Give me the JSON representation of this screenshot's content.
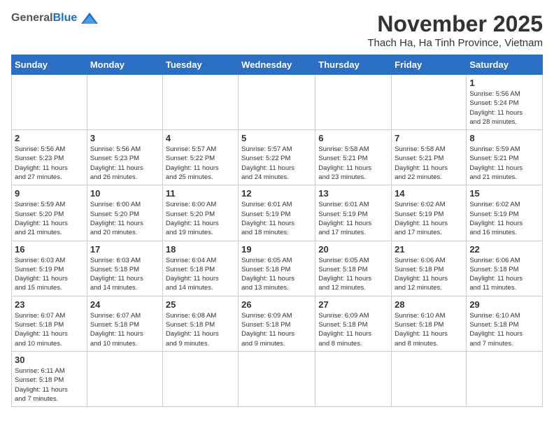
{
  "header": {
    "logo_general": "General",
    "logo_blue": "Blue",
    "month_title": "November 2025",
    "location": "Thach Ha, Ha Tinh Province, Vietnam"
  },
  "weekdays": [
    "Sunday",
    "Monday",
    "Tuesday",
    "Wednesday",
    "Thursday",
    "Friday",
    "Saturday"
  ],
  "weeks": [
    [
      {
        "day": "",
        "info": ""
      },
      {
        "day": "",
        "info": ""
      },
      {
        "day": "",
        "info": ""
      },
      {
        "day": "",
        "info": ""
      },
      {
        "day": "",
        "info": ""
      },
      {
        "day": "",
        "info": ""
      },
      {
        "day": "1",
        "info": "Sunrise: 5:56 AM\nSunset: 5:24 PM\nDaylight: 11 hours\nand 28 minutes."
      }
    ],
    [
      {
        "day": "2",
        "info": "Sunrise: 5:56 AM\nSunset: 5:23 PM\nDaylight: 11 hours\nand 27 minutes."
      },
      {
        "day": "3",
        "info": "Sunrise: 5:56 AM\nSunset: 5:23 PM\nDaylight: 11 hours\nand 26 minutes."
      },
      {
        "day": "4",
        "info": "Sunrise: 5:57 AM\nSunset: 5:22 PM\nDaylight: 11 hours\nand 25 minutes."
      },
      {
        "day": "5",
        "info": "Sunrise: 5:57 AM\nSunset: 5:22 PM\nDaylight: 11 hours\nand 24 minutes."
      },
      {
        "day": "6",
        "info": "Sunrise: 5:58 AM\nSunset: 5:21 PM\nDaylight: 11 hours\nand 23 minutes."
      },
      {
        "day": "7",
        "info": "Sunrise: 5:58 AM\nSunset: 5:21 PM\nDaylight: 11 hours\nand 22 minutes."
      },
      {
        "day": "8",
        "info": "Sunrise: 5:59 AM\nSunset: 5:21 PM\nDaylight: 11 hours\nand 21 minutes."
      }
    ],
    [
      {
        "day": "9",
        "info": "Sunrise: 5:59 AM\nSunset: 5:20 PM\nDaylight: 11 hours\nand 21 minutes."
      },
      {
        "day": "10",
        "info": "Sunrise: 6:00 AM\nSunset: 5:20 PM\nDaylight: 11 hours\nand 20 minutes."
      },
      {
        "day": "11",
        "info": "Sunrise: 6:00 AM\nSunset: 5:20 PM\nDaylight: 11 hours\nand 19 minutes."
      },
      {
        "day": "12",
        "info": "Sunrise: 6:01 AM\nSunset: 5:19 PM\nDaylight: 11 hours\nand 18 minutes."
      },
      {
        "day": "13",
        "info": "Sunrise: 6:01 AM\nSunset: 5:19 PM\nDaylight: 11 hours\nand 17 minutes."
      },
      {
        "day": "14",
        "info": "Sunrise: 6:02 AM\nSunset: 5:19 PM\nDaylight: 11 hours\nand 17 minutes."
      },
      {
        "day": "15",
        "info": "Sunrise: 6:02 AM\nSunset: 5:19 PM\nDaylight: 11 hours\nand 16 minutes."
      }
    ],
    [
      {
        "day": "16",
        "info": "Sunrise: 6:03 AM\nSunset: 5:19 PM\nDaylight: 11 hours\nand 15 minutes."
      },
      {
        "day": "17",
        "info": "Sunrise: 6:03 AM\nSunset: 5:18 PM\nDaylight: 11 hours\nand 14 minutes."
      },
      {
        "day": "18",
        "info": "Sunrise: 6:04 AM\nSunset: 5:18 PM\nDaylight: 11 hours\nand 14 minutes."
      },
      {
        "day": "19",
        "info": "Sunrise: 6:05 AM\nSunset: 5:18 PM\nDaylight: 11 hours\nand 13 minutes."
      },
      {
        "day": "20",
        "info": "Sunrise: 6:05 AM\nSunset: 5:18 PM\nDaylight: 11 hours\nand 12 minutes."
      },
      {
        "day": "21",
        "info": "Sunrise: 6:06 AM\nSunset: 5:18 PM\nDaylight: 11 hours\nand 12 minutes."
      },
      {
        "day": "22",
        "info": "Sunrise: 6:06 AM\nSunset: 5:18 PM\nDaylight: 11 hours\nand 11 minutes."
      }
    ],
    [
      {
        "day": "23",
        "info": "Sunrise: 6:07 AM\nSunset: 5:18 PM\nDaylight: 11 hours\nand 10 minutes."
      },
      {
        "day": "24",
        "info": "Sunrise: 6:07 AM\nSunset: 5:18 PM\nDaylight: 11 hours\nand 10 minutes."
      },
      {
        "day": "25",
        "info": "Sunrise: 6:08 AM\nSunset: 5:18 PM\nDaylight: 11 hours\nand 9 minutes."
      },
      {
        "day": "26",
        "info": "Sunrise: 6:09 AM\nSunset: 5:18 PM\nDaylight: 11 hours\nand 9 minutes."
      },
      {
        "day": "27",
        "info": "Sunrise: 6:09 AM\nSunset: 5:18 PM\nDaylight: 11 hours\nand 8 minutes."
      },
      {
        "day": "28",
        "info": "Sunrise: 6:10 AM\nSunset: 5:18 PM\nDaylight: 11 hours\nand 8 minutes."
      },
      {
        "day": "29",
        "info": "Sunrise: 6:10 AM\nSunset: 5:18 PM\nDaylight: 11 hours\nand 7 minutes."
      }
    ],
    [
      {
        "day": "30",
        "info": "Sunrise: 6:11 AM\nSunset: 5:18 PM\nDaylight: 11 hours\nand 7 minutes."
      },
      {
        "day": "",
        "info": ""
      },
      {
        "day": "",
        "info": ""
      },
      {
        "day": "",
        "info": ""
      },
      {
        "day": "",
        "info": ""
      },
      {
        "day": "",
        "info": ""
      },
      {
        "day": "",
        "info": ""
      }
    ]
  ]
}
